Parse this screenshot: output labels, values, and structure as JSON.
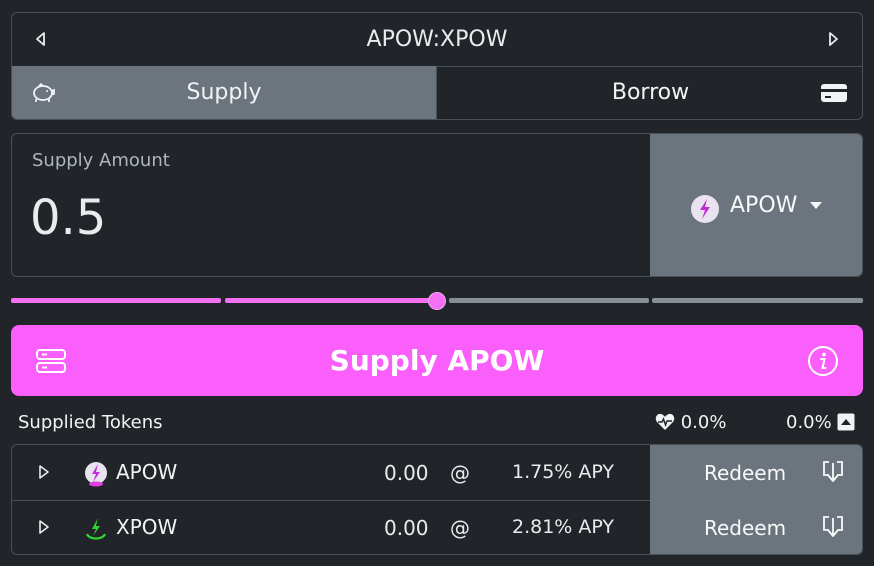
{
  "pair": {
    "title": "APOW:XPOW",
    "prev_icon": "chevron-left-icon",
    "next_icon": "chevron-right-icon"
  },
  "tabs": [
    {
      "label": "Supply",
      "icon": "piggy-bank-icon",
      "active": true
    },
    {
      "label": "Borrow",
      "icon": "credit-card-icon",
      "active": false
    }
  ],
  "amount": {
    "label": "Supply Amount",
    "value": "0.5",
    "token": "APOW"
  },
  "slider": {
    "value_fraction": 0.5,
    "accent": "#f36ff3",
    "track": "#868e96"
  },
  "action": {
    "label": "Supply APOW",
    "color": "#fb5ffb",
    "left_icon": "server-icon",
    "right_icon": "info-icon"
  },
  "supplied": {
    "title": "Supplied Tokens",
    "health": "0.0%",
    "percent": "0.0%",
    "rows": [
      {
        "token": "APOW",
        "amount": "0.00",
        "at": "@",
        "apy": "1.75% APY",
        "action": "Redeem"
      },
      {
        "token": "XPOW",
        "amount": "0.00",
        "at": "@",
        "apy": "2.81% APY",
        "action": "Redeem"
      }
    ]
  }
}
